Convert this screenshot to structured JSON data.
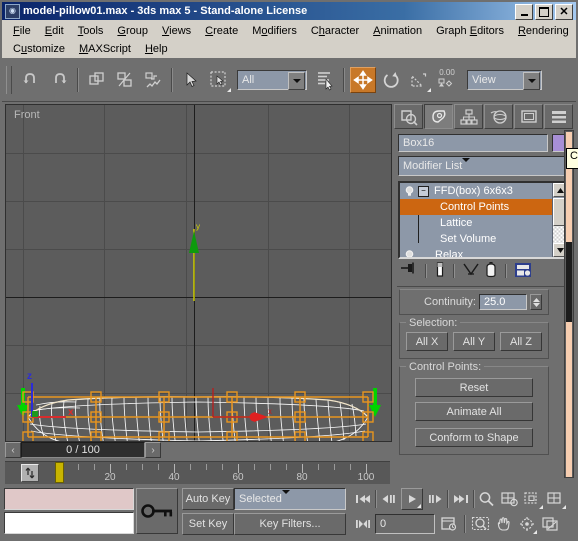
{
  "window": {
    "title": "model-pillow01.max - 3ds max 5 - Stand-alone License",
    "app_icon": "max-logo-icon",
    "minimize_label": "_",
    "maximize_label": "□",
    "close_label": "✕"
  },
  "menu": {
    "row1": [
      "File",
      "Edit",
      "Tools",
      "Group",
      "Views",
      "Create",
      "Modifiers",
      "Character",
      "Animation",
      "Graph Editors",
      "Rendering"
    ],
    "row2": [
      "Customize",
      "MAXScript",
      "Help"
    ]
  },
  "toolbar": {
    "buttons": [
      {
        "name": "undo-icon",
        "glyph": "↶"
      },
      {
        "name": "redo-icon",
        "glyph": "↷"
      },
      {
        "name": "select-and-link-icon",
        "glyph": "link"
      },
      {
        "name": "unlink-selection-icon",
        "glyph": "unlink"
      },
      {
        "name": "bind-to-space-warp-icon",
        "glyph": "bind"
      },
      {
        "name": "select-object-icon",
        "glyph": "arrow"
      },
      {
        "name": "select-region-icon",
        "glyph": "marquee"
      },
      {
        "name": "select-by-name-icon",
        "glyph": "by-name"
      },
      {
        "name": "select-and-move-icon",
        "glyph": "move"
      },
      {
        "name": "select-and-rotate-icon",
        "glyph": "rotate"
      },
      {
        "name": "select-and-uniform-scale-icon",
        "glyph": "scale"
      },
      {
        "name": "use-pivot-point-center-icon",
        "glyph": "pivot"
      }
    ],
    "selection_filter": "All",
    "reference_coord_system": "View",
    "angle_snap_value": "0.00",
    "active_tool": "select-and-move"
  },
  "viewport": {
    "label": "Front",
    "axis_y_label": "y",
    "axis_tripod": {
      "z": "z",
      "x": "x"
    },
    "object": "pillow-mesh-with-ffd-lattice",
    "lattice_color": "#e8951e",
    "mesh_color": "#ffffff",
    "gizmo_arrow_color": "#00d400"
  },
  "command_panel": {
    "tabs": [
      {
        "name": "tab-create",
        "glyph": "create-icon",
        "selected": false
      },
      {
        "name": "tab-modify",
        "glyph": "modify-icon",
        "selected": true
      },
      {
        "name": "tab-hierarchy",
        "glyph": "hierarchy-icon",
        "selected": false
      },
      {
        "name": "tab-motion",
        "glyph": "motion-icon",
        "selected": false
      },
      {
        "name": "tab-display",
        "glyph": "display-icon",
        "selected": false
      },
      {
        "name": "tab-utilities",
        "glyph": "utilities-icon",
        "selected": false
      }
    ],
    "object_name": "Box16",
    "object_color": "#a78fd6",
    "modifier_list_label": "Modifier List",
    "stack": [
      {
        "label": "FFD(box) 6x6x3",
        "level": 0,
        "selected": false,
        "has_bulb": true,
        "expanded": true
      },
      {
        "label": "Control Points",
        "level": 1,
        "selected": true,
        "has_bulb": false
      },
      {
        "label": "Lattice",
        "level": 1,
        "selected": false,
        "has_bulb": false
      },
      {
        "label": "Set Volume",
        "level": 1,
        "selected": false,
        "has_bulb": false
      },
      {
        "label": "Relax",
        "level": 0,
        "selected": false,
        "has_bulb": true
      }
    ],
    "stack_tools": [
      {
        "name": "pin-stack-icon"
      },
      {
        "name": "show-end-result-icon"
      },
      {
        "name": "make-unique-icon"
      },
      {
        "name": "remove-modifier-icon"
      },
      {
        "name": "configure-modifier-sets-icon"
      }
    ],
    "rollouts": {
      "continuity": {
        "label": "Continuity:",
        "value": "25.0"
      },
      "selection": {
        "title": "Selection:",
        "buttons": [
          "All X",
          "All Y",
          "All Z"
        ]
      },
      "control_points": {
        "title": "Control Points:",
        "buttons": [
          "Reset",
          "Animate All",
          "Conform to Shape"
        ]
      }
    },
    "tooltip_text": "C"
  },
  "time_slider": {
    "prev_label": "‹",
    "next_label": "›",
    "current": "0 / 100"
  },
  "track_bar": {
    "tick_labels": [
      "20",
      "40",
      "60",
      "80",
      "100"
    ],
    "tick_values": [
      20,
      40,
      60,
      80,
      100
    ],
    "range_start": 0,
    "range_end": 100,
    "current_frame": 0,
    "open_track_view_icon": "track-view-icon"
  },
  "status_bar": {
    "prompt_field_value": "",
    "status_field_value": "",
    "key_lock_icon": "key-icon",
    "auto_key_label": "Auto Key",
    "set_key_label": "Set Key",
    "key_mode_selected": "Selected",
    "key_filters_label": "Key Filters...",
    "current_time_value": "0",
    "playback_buttons": [
      {
        "name": "go-to-start-button",
        "glyph": "|◀◀"
      },
      {
        "name": "previous-frame-button",
        "glyph": "◀||"
      },
      {
        "name": "play-animation-button",
        "glyph": "▶"
      },
      {
        "name": "next-frame-button",
        "glyph": "||▶"
      },
      {
        "name": "go-to-end-button",
        "glyph": "▶▶|"
      },
      {
        "name": "key-mode-toggle-button",
        "glyph": "|◀▶|"
      }
    ],
    "nav_buttons": [
      {
        "name": "zoom-icon",
        "glyph": "magnifier"
      },
      {
        "name": "zoom-all-icon",
        "glyph": "zoom-all"
      },
      {
        "name": "zoom-extents-icon",
        "glyph": "zoom-extents"
      },
      {
        "name": "zoom-extents-all-icon",
        "glyph": "zoom-extents-all"
      },
      {
        "name": "region-zoom-icon",
        "glyph": "region-zoom"
      },
      {
        "name": "pan-icon",
        "glyph": "hand"
      },
      {
        "name": "arc-rotate-icon",
        "glyph": "arc-rotate"
      },
      {
        "name": "min-max-toggle-icon",
        "glyph": "min-max"
      }
    ],
    "time-config-icon": "time-configuration-icon"
  },
  "colors": {
    "title_bar_start": "#0a246a",
    "title_bar_end": "#a6ca f0",
    "ui_gray": "#6f6f6f",
    "viewport_bg": "#5c5c5c",
    "accent_orange": "#cc6611",
    "field_blue": "#8d98a8",
    "scrollbar_peach": "#f6cdb0"
  }
}
